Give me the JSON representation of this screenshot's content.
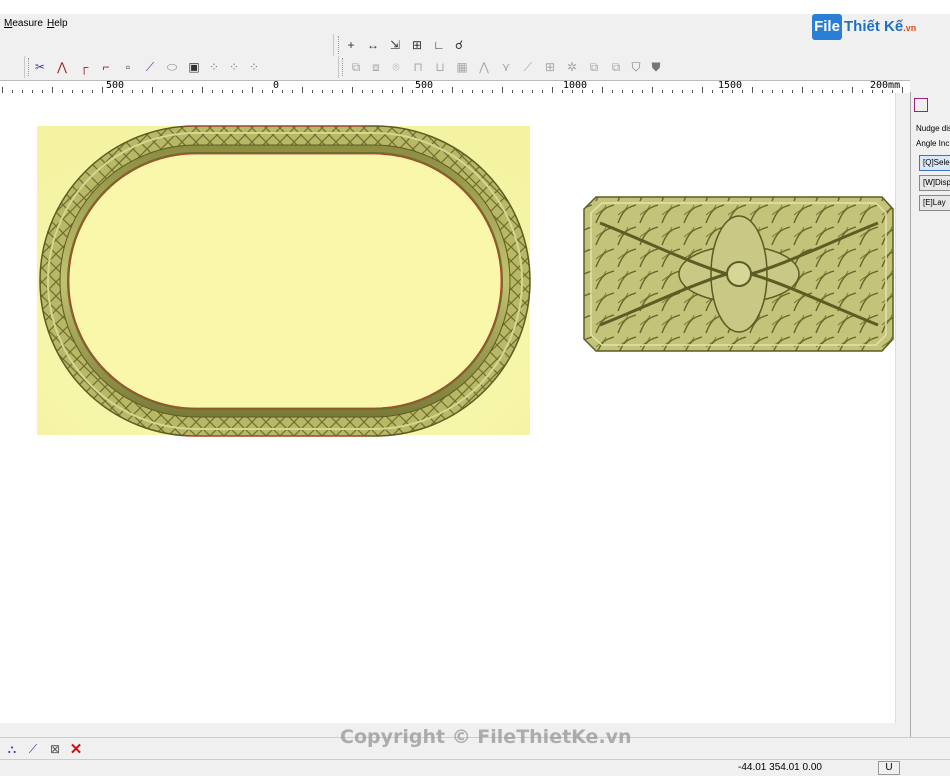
{
  "menu": {
    "items": [
      "Measure",
      "Help"
    ]
  },
  "logo": {
    "main": "File",
    "rest": "Thiết Kế",
    "suffix": ".vn"
  },
  "toolbar_top_right": {
    "icons": [
      "plus-icon",
      "measure-distance-icon",
      "transform-icon",
      "scale-icon",
      "angle-icon",
      "lasso-icon"
    ]
  },
  "toolbar_left": {
    "icons": [
      "trim-icon",
      "extend-icon",
      "fillet-icon",
      "chamfer-icon",
      "corner-icon",
      "curve-icon",
      "ellipse-icon",
      "frame-icon",
      "node-edit-icon",
      "node-edit-icon",
      "node-edit-icon"
    ]
  },
  "toolbar_right": {
    "icons": [
      "align-icon",
      "align-icon",
      "align-icon",
      "align-icon",
      "align-icon",
      "grid-icon",
      "polyline-icon",
      "polyline-icon",
      "polyline-icon",
      "array-icon",
      "sun-icon",
      "group-icon",
      "group-icon",
      "shield-icon",
      "shield-icon"
    ]
  },
  "ruler": {
    "labels": [
      "500",
      "0",
      "500",
      "1000",
      "1500",
      "200mm"
    ]
  },
  "panel": {
    "texts": [
      "Nudge dis",
      "Angle Inc"
    ],
    "buttons": [
      "[Q]Sele",
      "[W]Disp",
      "[E]Lay"
    ]
  },
  "bottom_toolbar": {
    "icons": [
      "tool-icon",
      "tool-icon",
      "tool-icon",
      "delete-icon"
    ]
  },
  "status": {
    "coords": "-44.01 354.01 0.00",
    "unit": "U"
  },
  "watermark": "Copyright © FileThietKe.vn",
  "colors": {
    "relief": "#b3b361",
    "relief_dark": "#6e6e2e",
    "bg_yellow": "#f7f6a8",
    "accent": "#2a7fd4"
  }
}
